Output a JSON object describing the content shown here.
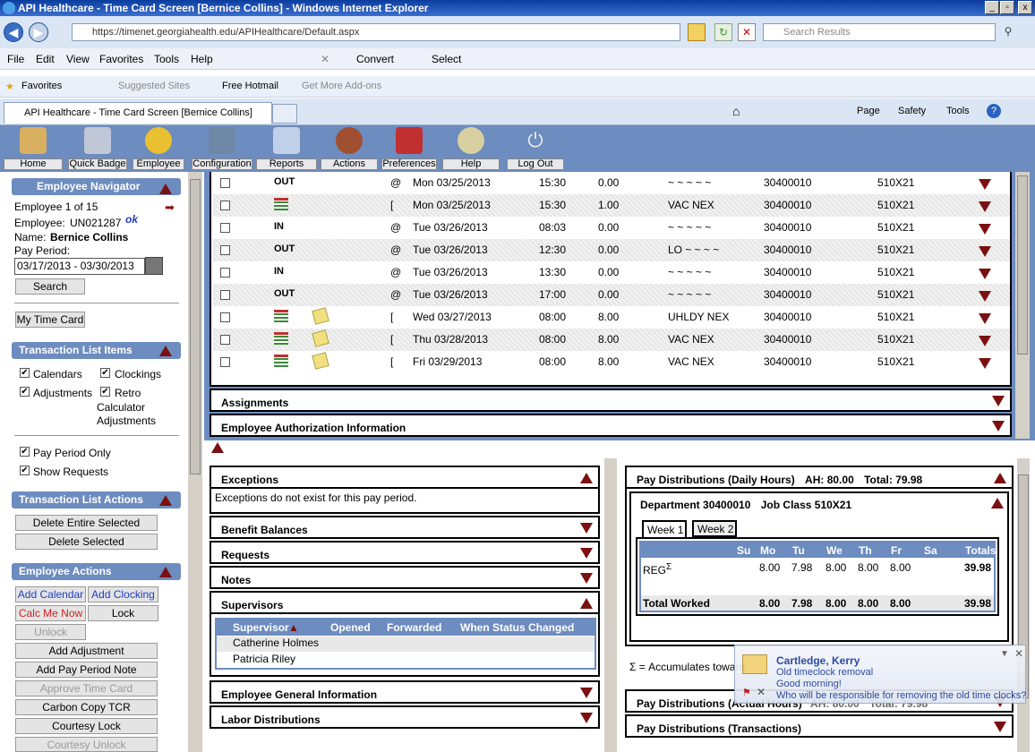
{
  "window": {
    "title": "API Healthcare - Time Card Screen [Bernice Collins] - Windows Internet Explorer"
  },
  "browser": {
    "url": "https://timenet.georgiahealth.edu/APIHealthcare/Default.aspx",
    "search_placeholder": "Search Results",
    "menu": [
      "File",
      "Edit",
      "View",
      "Favorites",
      "Tools",
      "Help"
    ],
    "convert": "Convert",
    "select": "Select",
    "favorites": "Favorites",
    "suggested": "Suggested Sites",
    "hotmail": "Free Hotmail",
    "addons": "Get More Add-ons",
    "tab": "API Healthcare - Time Card Screen [Bernice Collins]",
    "cmd": {
      "page": "Page",
      "safety": "Safety",
      "tools": "Tools"
    }
  },
  "toolbar": [
    "Home",
    "Quick Badge",
    "Employee",
    "Configuration",
    "Reports",
    "Actions",
    "Preferences",
    "Help",
    "Log Out"
  ],
  "nav": {
    "title": "Employee Navigator",
    "count": "Employee 1 of 15",
    "emp_label": "Employee:",
    "emp_id": "UN021287",
    "ok": "ok",
    "name_label": "Name:",
    "name": "Bernice Collins",
    "period_label": "Pay Period:",
    "period": "03/17/2013 - 03/30/2013",
    "search": "Search",
    "mytc": "My Time Card"
  },
  "tli": {
    "title": "Transaction List Items",
    "calendars": "Calendars",
    "clockings": "Clockings",
    "adjustments": "Adjustments",
    "retro": "Retro",
    "retro2": "Calculator",
    "retro3": "Adjustments",
    "ppo": "Pay Period Only",
    "showreq": "Show Requests"
  },
  "tla": {
    "title": "Transaction List Actions",
    "del_all": "Delete Entire Selected",
    "del_sel": "Delete Selected"
  },
  "ea": {
    "title": "Employee Actions",
    "add_cal": "Add Calendar",
    "add_clk": "Add Clocking",
    "calc": "Calc Me Now",
    "lock": "Lock",
    "unlock": "Unlock",
    "add_adj": "Add Adjustment",
    "add_ppn": "Add Pay Period Note",
    "approve": "Approve Time Card",
    "ccopy": "Carbon Copy TCR",
    "clock": "Courtesy Lock",
    "cunlock": "Courtesy Unlock"
  },
  "rows": [
    {
      "type": "OUT",
      "mark": "@",
      "date": "Mon 03/25/2013",
      "time": "15:30",
      "hours": "0.00",
      "code": "~ ~ ~ ~ ~",
      "dept": "30400010",
      "job": "510X21"
    },
    {
      "type": "",
      "mark": "[",
      "date": "Mon 03/25/2013",
      "time": "15:30",
      "hours": "1.00",
      "code": "VAC NEX",
      "dept": "30400010",
      "job": "510X21"
    },
    {
      "type": "IN",
      "mark": "@",
      "date": "Tue 03/26/2013",
      "time": "08:03",
      "hours": "0.00",
      "code": "~ ~ ~ ~ ~",
      "dept": "30400010",
      "job": "510X21"
    },
    {
      "type": "OUT",
      "mark": "@",
      "date": "Tue 03/26/2013",
      "time": "12:30",
      "hours": "0.00",
      "code": "LO ~ ~ ~ ~",
      "dept": "30400010",
      "job": "510X21"
    },
    {
      "type": "IN",
      "mark": "@",
      "date": "Tue 03/26/2013",
      "time": "13:30",
      "hours": "0.00",
      "code": "~ ~ ~ ~ ~",
      "dept": "30400010",
      "job": "510X21"
    },
    {
      "type": "OUT",
      "mark": "@",
      "date": "Tue 03/26/2013",
      "time": "17:00",
      "hours": "0.00",
      "code": "~ ~ ~ ~ ~",
      "dept": "30400010",
      "job": "510X21"
    },
    {
      "type": "",
      "mark": "[",
      "date": "Wed 03/27/2013",
      "time": "08:00",
      "hours": "8.00",
      "code": "UHLDY NEX",
      "dept": "30400010",
      "job": "510X21"
    },
    {
      "type": "",
      "mark": "[",
      "date": "Thu 03/28/2013",
      "time": "08:00",
      "hours": "8.00",
      "code": "VAC NEX",
      "dept": "30400010",
      "job": "510X21"
    },
    {
      "type": "",
      "mark": "[",
      "date": "Fri 03/29/2013",
      "time": "08:00",
      "hours": "8.00",
      "code": "VAC NEX",
      "dept": "30400010",
      "job": "510X21"
    }
  ],
  "sections": {
    "assign": "Assignments",
    "auth": "Employee Authorization Information",
    "exc": "Exceptions",
    "exc_msg": "Exceptions do not exist for this pay period.",
    "bal": "Benefit Balances",
    "req": "Requests",
    "notes": "Notes",
    "sup": "Supervisors",
    "gen": "Employee General Information",
    "labor": "Labor Distributions"
  },
  "sup": {
    "cols": [
      "Supervisor",
      "Opened",
      "Forwarded",
      "When Status Changed"
    ],
    "names": [
      "Catherine Holmes",
      "Patricia Riley"
    ]
  },
  "pd": {
    "title": "Pay Distributions (Daily Hours)",
    "ah": "AH: 80.00",
    "total": "Total: 79.98",
    "dept": "Department 30400010",
    "job": "Job Class 510X21",
    "week1": "Week 1",
    "week2": "Week 2",
    "cols": [
      "Su",
      "Mo",
      "Tu",
      "We",
      "Th",
      "Fr",
      "Sa",
      "Totals"
    ],
    "reg": "REG",
    "reg_vals": [
      "",
      "8.00",
      "7.98",
      "8.00",
      "8.00",
      "8.00",
      "",
      "39.98"
    ],
    "tw": "Total Worked",
    "tw_vals": [
      "",
      "8.00",
      "7.98",
      "8.00",
      "8.00",
      "8.00",
      "",
      "39.98"
    ],
    "note": "= Accumulates toward",
    "actual": "Pay Distributions (Actual Hours)",
    "actual_ah": "AH: 80.00",
    "actual_total": "Total: 79.98",
    "trans": "Pay Distributions (Transactions)"
  },
  "toast": {
    "name": "Cartledge, Kerry",
    "l1": "Old timeclock removal",
    "l2": "Good morning!",
    "l3": "Who will be responsible for removing the old time clocks?"
  }
}
